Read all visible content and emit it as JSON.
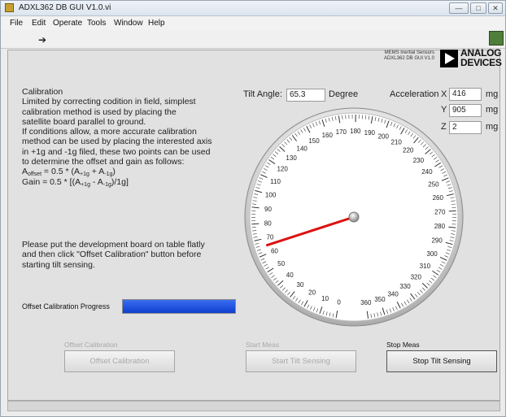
{
  "window": {
    "title": "ADXL362 DB GUI V1.0.vi",
    "buttons": [
      "—",
      "□",
      "✕"
    ]
  },
  "menu": [
    "File",
    "Edit",
    "Operate",
    "Tools",
    "Window",
    "Help"
  ],
  "header": {
    "mems_line1": "MEMS Inertial Sensors",
    "mems_line2": "ADXL362 DB GUI V1.0",
    "logo_line1": "ANALOG",
    "logo_line2": "DEVICES"
  },
  "calibration": {
    "title": "Calibration",
    "lines": [
      "Limited by correcting codition in field, simplest",
      "calibration method is used by placing the",
      "satellite board parallel to ground.",
      "If conditions allow, a more accurate calibration",
      "method can be used by placing the interested axis",
      "in +1g and -1g filed, these two points can be used",
      "to determine the offset and gain as follows:"
    ],
    "offset_formula": {
      "lhs": "A",
      "lhs_sub": "offset",
      "rhs_pre": " = 0.5 * (A",
      "sub1": "+1g",
      "mid": " + A",
      "sub2": "-1g",
      "post": ")"
    },
    "gain_formula": {
      "lhs": "Gain = 0.5 * [(A",
      "sub1": "+1g",
      "mid": " - A",
      "sub2": "-1g",
      "post": ")/1g]"
    }
  },
  "instructions": [
    "Please put the development board on table flatly",
    "and then click \"Offset Calibration\" button before",
    "starting tilt sensing."
  ],
  "tilt": {
    "label": "Tilt Angle:",
    "value": "65.3",
    "unit": "Degree",
    "angle": 65.3
  },
  "acceleration": {
    "label": "Acceleration",
    "x_label": "X",
    "x_value": "416",
    "y_label": "Y",
    "y_value": "905",
    "z_label": "Z",
    "z_value": "2",
    "unit": "mg"
  },
  "gauge": {
    "min": 0,
    "max": 360,
    "major_step": 10,
    "minor_per_major": 5,
    "needle_color": "#dd1111"
  },
  "progress": {
    "label": "Offset Calibration Progress",
    "fraction": 1.0,
    "color": "#1f4fe0"
  },
  "buttons": {
    "offset_caption": "Offset Calibration",
    "offset_label": "Offset Calibration",
    "start_caption": "Start Meas",
    "start_label": "Start Tilt Sensing",
    "stop_caption": "Stop Meas",
    "stop_label": "Stop Tilt Sensing"
  }
}
